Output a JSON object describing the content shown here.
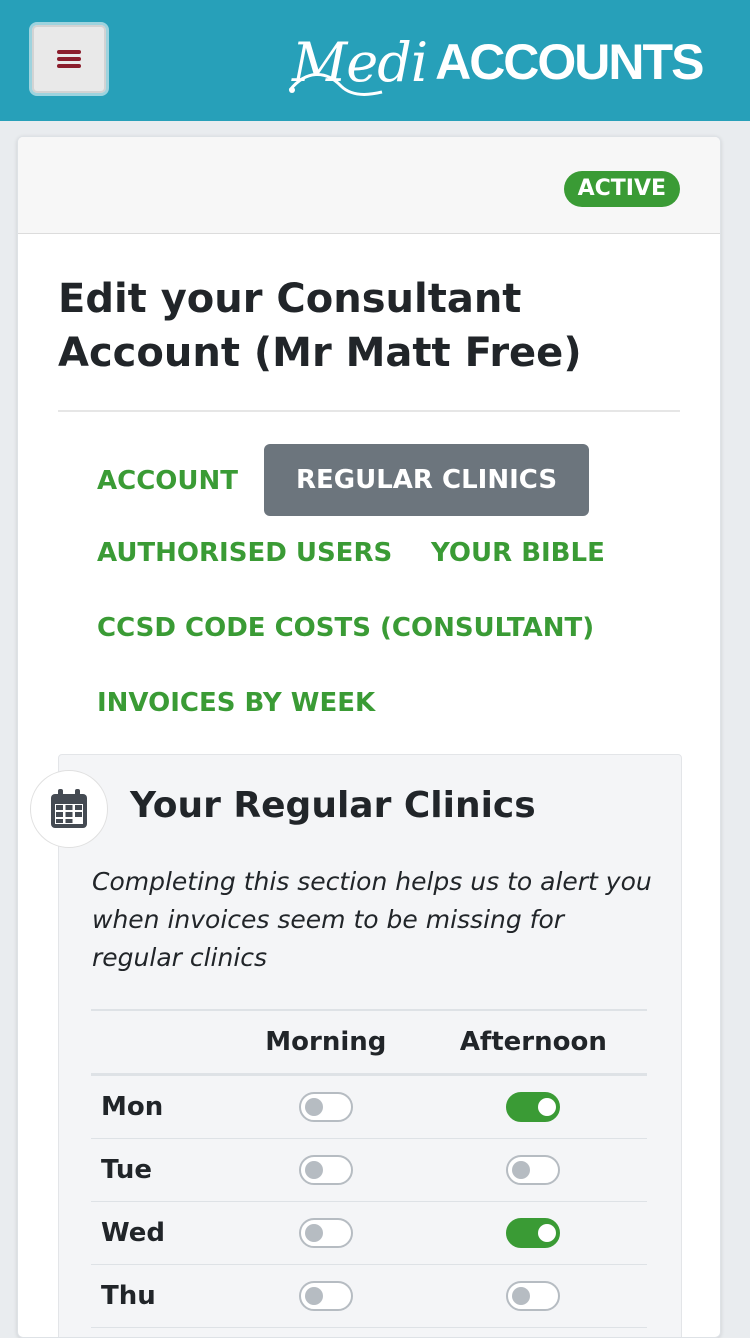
{
  "header": {
    "menu_icon": "hamburger-menu-icon",
    "logo_script": "Medi",
    "logo_text": "ACCOUNTS",
    "background_color": "#27a0b9"
  },
  "status_badge": {
    "label": "ACTIVE",
    "color": "#3a9b35"
  },
  "page_title": "Edit your Consultant Account (Mr Matt Free)",
  "tabs": [
    {
      "label": "ACCOUNT",
      "active": false
    },
    {
      "label": "REGULAR CLINICS",
      "active": true
    },
    {
      "label": "AUTHORISED USERS",
      "active": false
    },
    {
      "label": "YOUR BIBLE",
      "active": false
    },
    {
      "label": "CCSD CODE COSTS (CONSULTANT)",
      "active": false
    },
    {
      "label": "INVOICES BY WEEK",
      "active": false
    }
  ],
  "clinics": {
    "icon": "calendar-icon",
    "title": "Your Regular Clinics",
    "description": "Completing this section helps us to alert you when invoices seem to be missing for regular clinics",
    "columns": [
      "",
      "Morning",
      "Afternoon"
    ],
    "rows": [
      {
        "day": "Mon",
        "morning": false,
        "afternoon": true
      },
      {
        "day": "Tue",
        "morning": false,
        "afternoon": false
      },
      {
        "day": "Wed",
        "morning": false,
        "afternoon": true
      },
      {
        "day": "Thu",
        "morning": false,
        "afternoon": false
      }
    ]
  }
}
